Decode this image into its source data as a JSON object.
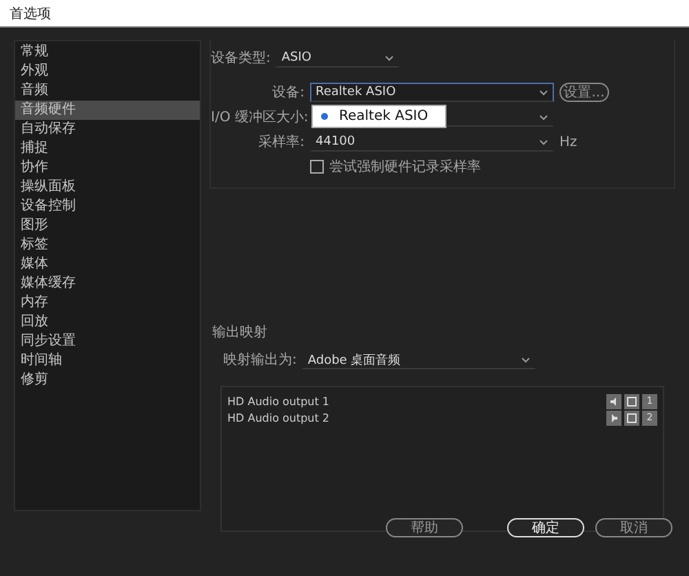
{
  "window": {
    "title": "首选项"
  },
  "sidebar": {
    "items": [
      {
        "label": "常规",
        "selected": false
      },
      {
        "label": "外观",
        "selected": false
      },
      {
        "label": "音频",
        "selected": false
      },
      {
        "label": "音频硬件",
        "selected": true
      },
      {
        "label": "自动保存",
        "selected": false
      },
      {
        "label": "捕捉",
        "selected": false
      },
      {
        "label": "协作",
        "selected": false
      },
      {
        "label": "操纵面板",
        "selected": false
      },
      {
        "label": "设备控制",
        "selected": false
      },
      {
        "label": "图形",
        "selected": false
      },
      {
        "label": "标签",
        "selected": false
      },
      {
        "label": "媒体",
        "selected": false
      },
      {
        "label": "媒体缓存",
        "selected": false
      },
      {
        "label": "内存",
        "selected": false
      },
      {
        "label": "回放",
        "selected": false
      },
      {
        "label": "同步设置",
        "selected": false
      },
      {
        "label": "时间轴",
        "selected": false
      },
      {
        "label": "修剪",
        "selected": false
      }
    ]
  },
  "device_type": {
    "label": "设备类型:",
    "value": "ASIO"
  },
  "device": {
    "label": "设备:",
    "value": "Realtek ASIO",
    "button": "设置...",
    "dropdown": [
      {
        "label": "Realtek ASIO",
        "selected": true
      }
    ]
  },
  "buffer_size": {
    "label": "I/O 缓冲区大小:"
  },
  "sample_rate": {
    "label": "采样率:",
    "value": "44100",
    "unit": "Hz"
  },
  "force_rate": {
    "label": "尝试强制硬件记录采样率",
    "checked": false
  },
  "output_mapping": {
    "title": "输出映射",
    "map_label": "映射输出为:",
    "map_value": "Adobe 桌面音频",
    "outputs": [
      {
        "name": "HD Audio output 1",
        "channel": "1"
      },
      {
        "name": "HD Audio output 2",
        "channel": "2"
      }
    ]
  },
  "buttons": [
    {
      "label": "帮助",
      "primary": false
    },
    {
      "label": "确定",
      "primary": true
    },
    {
      "label": "取消",
      "primary": false
    }
  ]
}
